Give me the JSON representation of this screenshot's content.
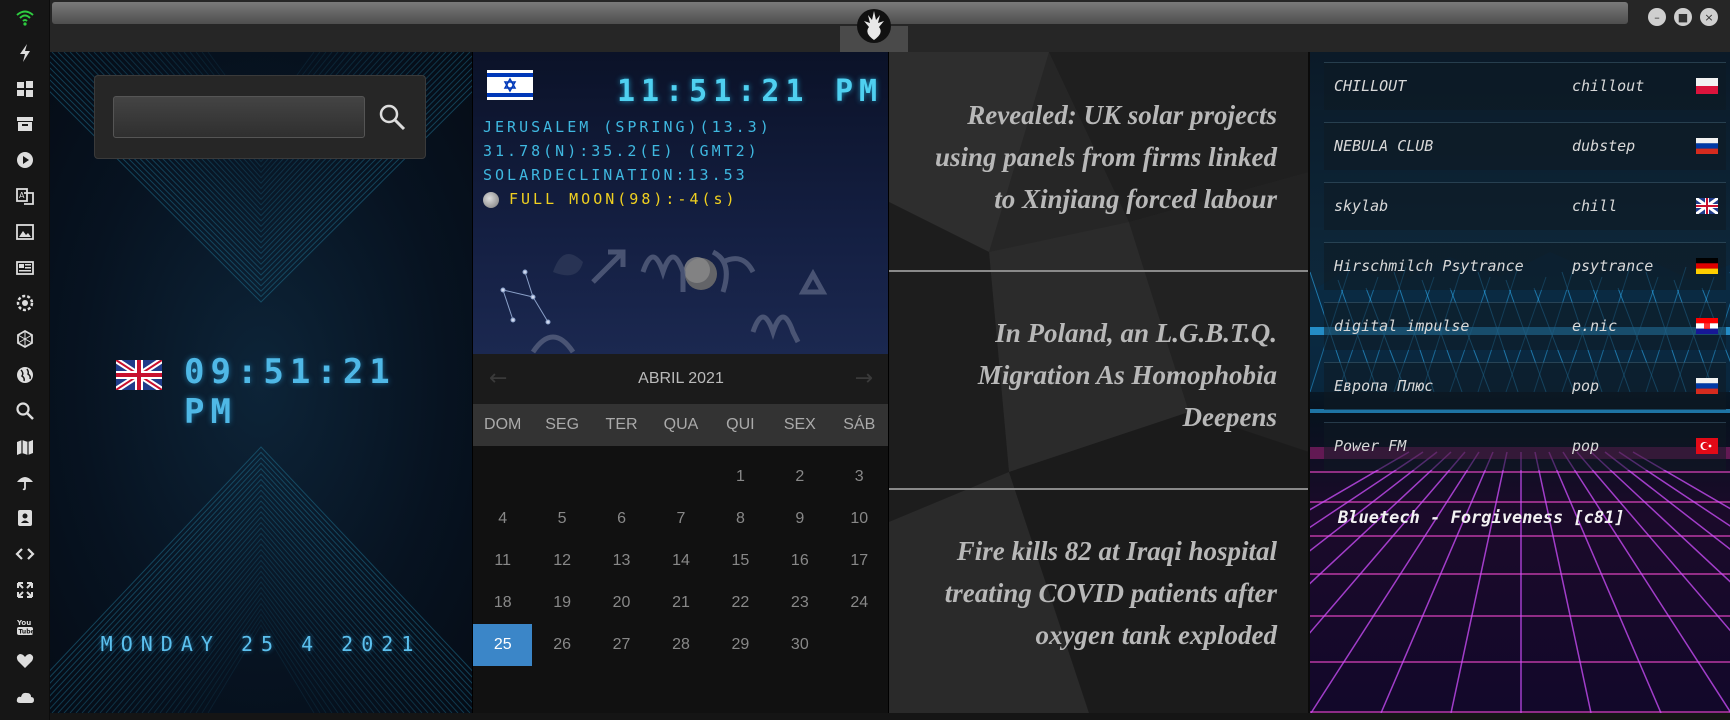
{
  "sidebar": {
    "icons": [
      "wifi-icon",
      "lightning-icon",
      "windows-icon",
      "archive-icon",
      "play-icon",
      "translate-icon",
      "image-icon",
      "news-icon",
      "settings-icon",
      "hexagon-icon",
      "globe-icon",
      "search-icon",
      "map-icon",
      "umbrella-icon",
      "contacts-icon",
      "code-icon",
      "expand-icon",
      "youtube-icon",
      "heart-icon",
      "cloud-icon"
    ],
    "accent": "#2ecc40"
  },
  "titlebar": {
    "logo": "rebel-alliance-icon",
    "buttons": [
      "minimize",
      "maximize",
      "close"
    ]
  },
  "local_clock": {
    "search": {
      "value": "",
      "placeholder": ""
    },
    "flag": "uk-flag",
    "time": "09:51:21  PM",
    "date": "MONDAY 25 4 2021"
  },
  "world_clock": {
    "flag": "israel-flag",
    "time": "11:51:21",
    "ampm": "PM",
    "line1": "JERUSALEM (SPRING)(13.3)",
    "line2": "31.78(N):35.2(E) (GMT2)",
    "line3": "SOLARDECLINATION:13.53",
    "moon": "FULL MOON(98):-4(s)"
  },
  "calendar": {
    "prev": "←",
    "next": "→",
    "title": "ABRIL 2021",
    "dow": [
      "DOM",
      "SEG",
      "TER",
      "QUA",
      "QUI",
      "SEX",
      "SÁB"
    ],
    "weeks": [
      [
        "",
        "",
        "",
        "",
        "1",
        "2",
        "3"
      ],
      [
        "4",
        "5",
        "6",
        "7",
        "8",
        "9",
        "10"
      ],
      [
        "11",
        "12",
        "13",
        "14",
        "15",
        "16",
        "17"
      ],
      [
        "18",
        "19",
        "20",
        "21",
        "22",
        "23",
        "24"
      ],
      [
        "25",
        "26",
        "27",
        "28",
        "29",
        "30",
        ""
      ]
    ],
    "today": "25",
    "today_color": "#3b86c8"
  },
  "news": {
    "items": [
      {
        "headline": "Revealed: UK solar projects using panels from firms linked to Xinjiang forced labour"
      },
      {
        "headline": "In Poland, an L.G.B.T.Q. Migration As Homophobia Deepens"
      },
      {
        "headline": "Fire kills 82 at Iraqi hospital treating COVID patients after oxygen tank exploded"
      }
    ]
  },
  "radio": {
    "stations": [
      {
        "name": "CHILLOUT",
        "genre": "chillout",
        "flag": "poland-flag"
      },
      {
        "name": "NEBULA CLUB",
        "genre": "dubstep",
        "flag": "russia-flag"
      },
      {
        "name": "skylab",
        "genre": "chill",
        "flag": "uk-flag"
      },
      {
        "name": "Hirschmilch Psytrance",
        "genre": "psytrance",
        "flag": "germany-flag"
      },
      {
        "name": "digital impulse",
        "genre": "e.nic",
        "flag": "croatia-flag"
      },
      {
        "name": "Европа Плюс",
        "genre": "pop",
        "flag": "russia-flag"
      },
      {
        "name": "Power FM",
        "genre": "pop",
        "flag": "turkey-flag"
      }
    ],
    "now_playing": "Bluetech - Forgiveness [c81]"
  }
}
